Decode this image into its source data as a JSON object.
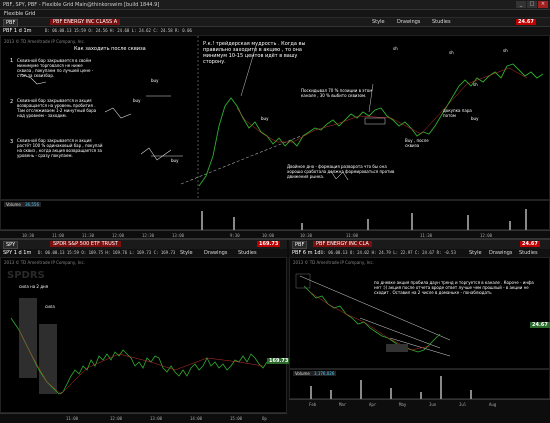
{
  "window": {
    "title": "PBF, SPY, PBF - Flexible Grid Main@thinkorswim [build 1844.9]",
    "subtitle": "Flexible Grid"
  },
  "main_chart": {
    "symbol": "PBF",
    "company_header": "PBF ENERGY INC CLASS A",
    "price": "24.67",
    "timeframe": "PBF 1 d 1m",
    "ohlc": "D: 06.08.13 15:59  O: 24.56  H: 24.68  L: 24.62  C: 24.58  R: 0.06",
    "buttons": [
      "Style",
      "Drawings",
      "Studies"
    ],
    "source_line": "2013 © TD Ameritrade IP Company, Inc.",
    "volume_label": "Volume",
    "volume_value": "36,556",
    "x_ticks": [
      "10:30",
      "11:00",
      "11:30",
      "12:00",
      "12:30",
      "13:00",
      "13:30",
      "14:00",
      "14:30",
      "15:00",
      "15:30",
      "9:30",
      "10:00",
      "10:30",
      "11:00",
      "11:30",
      "12:00"
    ]
  },
  "notes_left": {
    "title": "Как заходить после сквиза",
    "items": [
      "Сквизной бар закрывается в своём минимуме торговался не ниже сквиза , покупаем по лучшей цене - стоп за сквизбар.",
      "Сквизной бар закрывается и акция возвращается на уровень пробития . Там отслеживаем 1-2 минутный бара над уровнем - заходим.",
      "Сквизной бар закрывается и акция растёт 100 % одинаковый бар , покупай на сквиз , когда акция возвращается за уровень - сразу покупаем."
    ],
    "labels": [
      "1",
      "2",
      "3",
      "buy",
      "buy",
      "buy"
    ]
  },
  "notes_right": {
    "quote": "Р.к.! трейдерская мудрость . Когда вы правильно заходите в акцию , то она минимум 10-15 центов идёт в вашу сторону.",
    "partial": "Поскидывал 70 % позиции в этом канале , 30 % выбито сквизом.",
    "double_bottom": "Двойное дно - формация разворота что бы она хорошо сработала должна формироваться против движения рынка.",
    "buy_after_squeeze": "Buy , после сквиза",
    "add_after_squeeze": "докупка пара потом",
    "labels": [
      "buy",
      "sh",
      "sh",
      "sh",
      "sh",
      "buy"
    ]
  },
  "spy_chart": {
    "symbol": "SPY",
    "company_header": "SPDR S&P 500 ETF TRUST",
    "price": "169.73",
    "timeframe": "SPY 1 d 1m",
    "ohlc": "D: 06.08.13 15:59  O: 169.75  H: 169.76  L: 169.73  C: 169.73",
    "buttons": [
      "Style",
      "Drawings",
      "Studies"
    ],
    "source_line": "2013 © TD Ameritrade IP Company, Inc.",
    "watermark": "SPDRS",
    "side_price": "169.73",
    "notes": [
      "сила на 2 дня",
      "сила"
    ],
    "x_ticks": [
      "11:00",
      "12:00",
      "13:00",
      "14:00",
      "15:00",
      "Op"
    ]
  },
  "pbf_small_chart": {
    "symbol": "PBF",
    "company_header": "PBF ENERGY INC CLA",
    "price": "24.67",
    "timeframe": "PBF 6 m 1d",
    "ohlc": "D: 06.08.13  O: 24.02  H: 24.79  L: 22.97  C: 24.67  R: -0.53",
    "buttons": [
      "Style",
      "Drawings",
      "Studies"
    ],
    "source_line": "2013 © TD Ameritrade IP Company, Inc.",
    "note": "по дневке акция пробила даун тренд и торгуется в канале . Короче - инфа нет :)) акция после отчета вроде ответ лучше чем прошлый - в акции не сходит . Оставил на 2 числе в доманьке - понаблюдать",
    "volume_label": "Volume",
    "volume_value": "3,176,026",
    "side_price": "24.67",
    "x_ticks": [
      "Feb",
      "Mar",
      "Apr",
      "May",
      "Jun",
      "Jul",
      "Aug"
    ]
  }
}
